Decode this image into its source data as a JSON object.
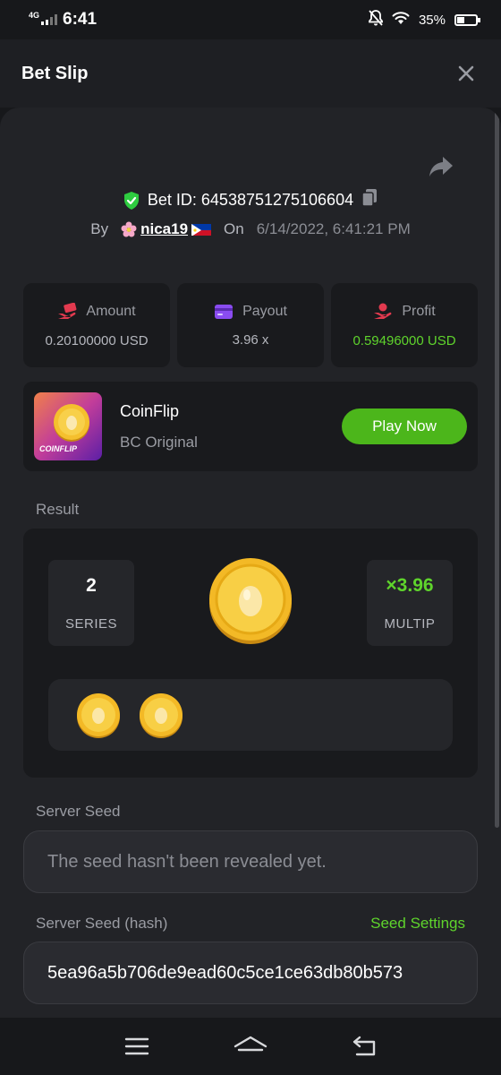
{
  "status_bar": {
    "network": "4G",
    "time": "6:41",
    "battery": "35%"
  },
  "header": {
    "title": "Bet Slip"
  },
  "bet": {
    "id_label": "Bet ID: 64538751275106604",
    "by_label": "By",
    "user": "nica19",
    "on_label": "On",
    "date": "6/14/2022, 6:41:21 PM"
  },
  "stats": [
    {
      "label": "Amount",
      "value": "0.20100000 USD",
      "icon": "money-hand-icon",
      "color": "#e23a4f"
    },
    {
      "label": "Payout",
      "value": "3.96 x",
      "icon": "wallet-card-icon",
      "color": "#8a4cf0"
    },
    {
      "label": "Profit",
      "value": "0.59496000 USD",
      "icon": "profit-hand-icon",
      "color": "#e23a4f"
    }
  ],
  "game": {
    "name": "CoinFlip",
    "subtitle": "BC Original",
    "thumb_label": "COINFLIP",
    "play_label": "Play Now"
  },
  "result": {
    "section_label": "Result",
    "series_value": "2",
    "series_label": "SERIES",
    "multiplier_value": "×3.96",
    "multiplier_label": "MULTIP",
    "history_count": 2
  },
  "server_seed": {
    "label": "Server Seed",
    "value": "The seed hasn't been revealed yet."
  },
  "server_seed_hash": {
    "label": "Server Seed (hash)",
    "link": "Seed Settings",
    "value": "5ea96a5b706de9ead60c5ce1ce63db80b573"
  },
  "colors": {
    "accent_green": "#5fd42c",
    "button_green": "#4cb61b",
    "shield_green": "#2ecc40"
  }
}
